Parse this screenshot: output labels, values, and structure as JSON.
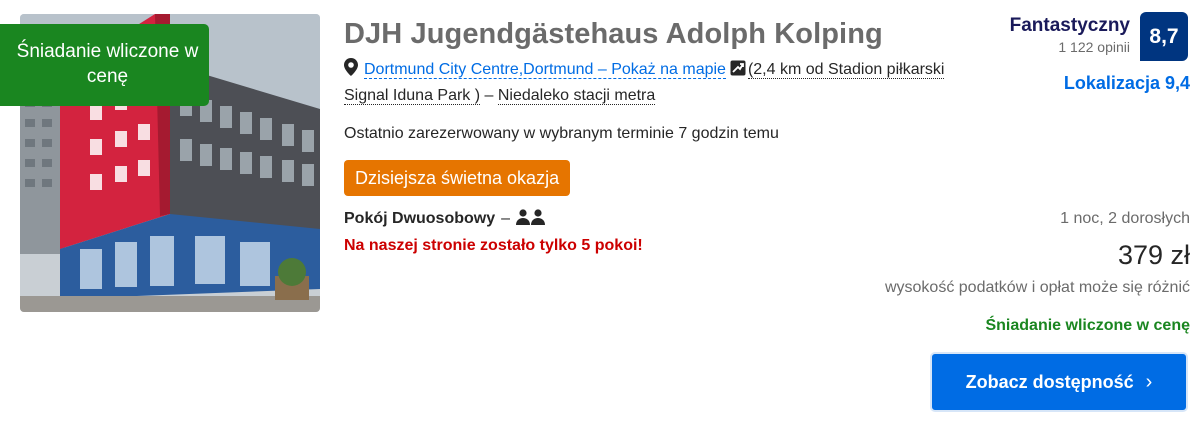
{
  "ribbon": {
    "text": "Śniadanie wliczone w cenę"
  },
  "hotel": {
    "name": "DJH Jugendgästehaus Adolph Kolping",
    "location_link": "Dortmund City Centre,Dortmund – Pokaż na mapie",
    "distance": "(2,4 km od Stadion piłkarski Signal Iduna Park )",
    "metro_sep": " – ",
    "metro": "Niedaleko stacji metra",
    "recent_booking": "Ostatnio zarezerwowany w wybranym terminie 7 godzin temu",
    "deal_badge": "Dzisiejsza świetna okazja",
    "room_type": "Pokój Dwuosobowy",
    "room_dash": "–",
    "rooms_left": "Na naszej stronie zostało tylko 5 pokoi!"
  },
  "review": {
    "word": "Fantastyczny",
    "count": "1 122 opinii",
    "score": "8,7",
    "location_score": "Lokalizacja 9,4"
  },
  "pricing": {
    "stay": "1 noc, 2 dorosłych",
    "price": "379 zł",
    "taxes_note": "wysokość podatków i opłat może się różnić",
    "breakfast": "Śniadanie wliczone w cenę"
  },
  "cta": {
    "label": "Zobacz dostępność",
    "chevron": "›"
  },
  "icons": {
    "pin": "map-pin-icon",
    "map": "map-view-icon",
    "people": "two-people-icon"
  },
  "colors": {
    "link": "#006ce4",
    "score_bg": "#003580",
    "green": "#1a8620",
    "orange": "#e67500",
    "red": "#cc0000",
    "cta": "#006ce4"
  }
}
